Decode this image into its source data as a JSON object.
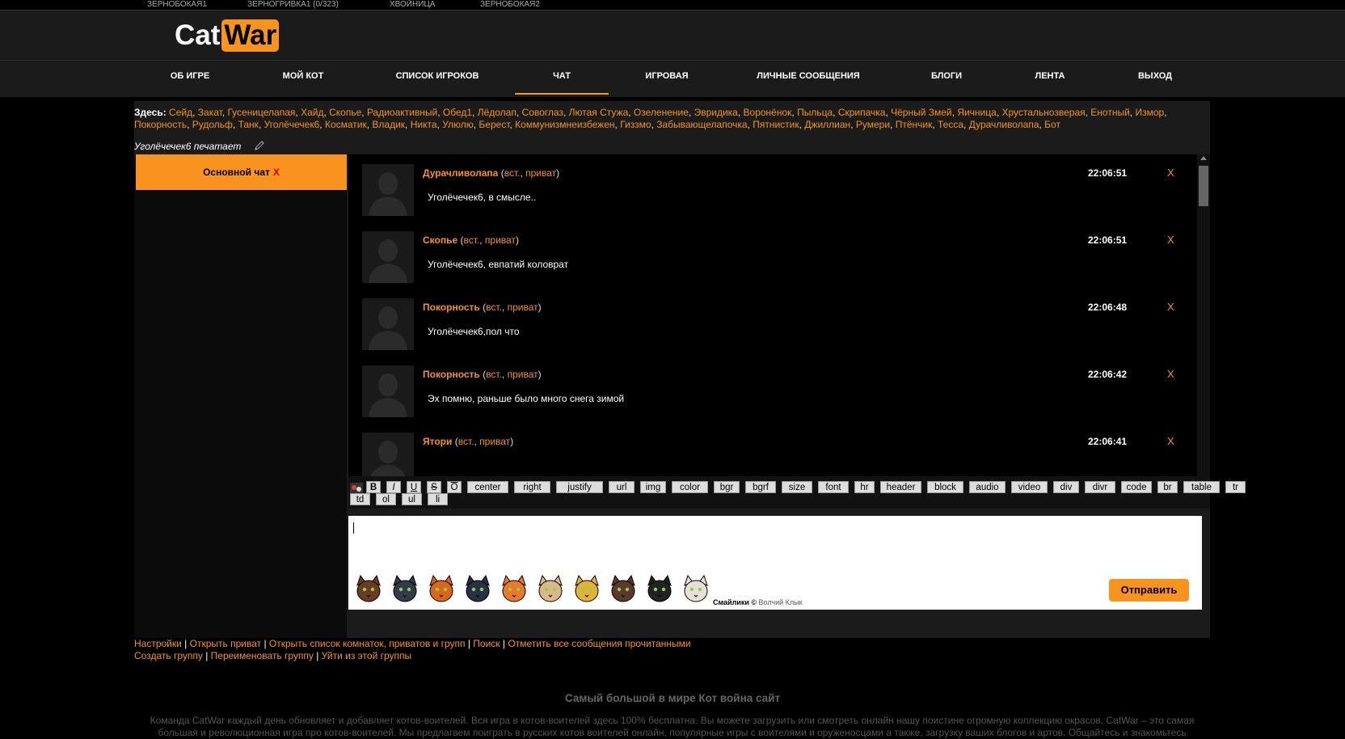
{
  "account_bar": {
    "accounts": [
      {
        "label": "ЗЕРНОБОКАЯ1"
      },
      {
        "label": "ЗЕРНОГРИВКА1 (0/323)"
      },
      {
        "label": "ХВОЙНИЦА"
      },
      {
        "label": "ЗЕРНОБОКАЯ2"
      }
    ]
  },
  "logo": {
    "part1": "Cat",
    "part2": "War"
  },
  "nav": {
    "items": [
      {
        "label": "ОБ ИГРЕ"
      },
      {
        "label": "МОЙ КОТ"
      },
      {
        "label": "СПИСОК ИГРОКОВ"
      },
      {
        "label": "ЧАТ",
        "active": true
      },
      {
        "label": "ИГРОВАЯ"
      },
      {
        "label": "ЛИЧНЫЕ СООБЩЕНИЯ"
      },
      {
        "label": "БЛОГИ"
      },
      {
        "label": "ЛЕНТА"
      },
      {
        "label": "ВЫХОД"
      }
    ]
  },
  "here": {
    "label": "Здесь:",
    "users": [
      "Сейд",
      "Закат",
      "Гусеницелапая",
      "Хайд",
      "Скопье",
      "Радиоактивный",
      "Обед1",
      "Лёдолап",
      "Совоглаз",
      "Лютая Стужа",
      "Озеленение",
      "Эвридика",
      "Воронёнок",
      "Пыльца",
      "Скрипачка",
      "Чёрный Змей",
      "Яичница",
      "Хрустальнозверая",
      "Енотный",
      "Измор",
      "Покорность",
      "Рудольф",
      "Танк",
      "Уголёчечек6",
      "Косматик",
      "Владик",
      "Никта",
      "Улюлю",
      "Берест",
      "Коммунизмнеизбежен",
      "Гиззмо",
      "Забывающелапочка",
      "Пятнистик",
      "Джиллиан",
      "Румери",
      "Птёнчик",
      "Тесса",
      "Дурачливолапа",
      "Бот"
    ],
    "typing": "Уголёчечек6 печатает"
  },
  "rooms": {
    "main_label": "Основной чат",
    "close_label": "X"
  },
  "messages": [
    {
      "author": "Дурачливолапа",
      "ins": "вст.",
      "priv": "приват",
      "text": "Уголёчечек6, в смысле..",
      "time": "22:06:51",
      "del": "X"
    },
    {
      "author": "Скопье",
      "ins": "вст.",
      "priv": "приват",
      "text": "Уголёчечек6, евпатий коловрат",
      "time": "22:06:51",
      "del": "X"
    },
    {
      "author": "Покорность",
      "ins": "вст.",
      "priv": "приват",
      "text": "Уголёчечек6,пол что",
      "time": "22:06:48",
      "del": "X"
    },
    {
      "author": "Покорность",
      "ins": "вст.",
      "priv": "приват",
      "text": "Эх помню, раньше было много снега зимой",
      "time": "22:06:42",
      "del": "X"
    },
    {
      "author": "Ятори",
      "ins": "вст.",
      "priv": "приват",
      "text": "",
      "time": "22:06:41",
      "del": "X"
    }
  ],
  "toolbar": {
    "row1": [
      "B",
      "I",
      "U",
      "S",
      "O",
      "center",
      "right",
      "justify",
      "url",
      "img",
      "color",
      "bgr",
      "bgrf",
      "size",
      "font",
      "hr",
      "header",
      "block",
      "audio",
      "video",
      "div",
      "divr",
      "code",
      "br",
      "table",
      "tr"
    ],
    "row2": [
      "td",
      "ol",
      "ul",
      "li"
    ]
  },
  "smileys": {
    "icons": [
      "brown-cat-smiley-icon",
      "grey-blue-cat-smiley-icon",
      "ginger-cat-smiley-icon",
      "navy-cat-question-smiley-icon",
      "orange-tabby-smiley-icon",
      "cream-cat-smiley-icon",
      "yellow-cat-smiley-icon",
      "brown-tabby-smiley-icon",
      "black-white-cat-smiley-icon",
      "calico-cat-smiley-icon"
    ],
    "credit_prefix": "Смайлики ©",
    "credit_author": "Волчий Клык"
  },
  "send_label": "Отправить",
  "footer": {
    "row1": [
      "Настройки",
      "Открыть приват",
      "Открыть список комнаток, приватов и групп",
      "Поиск",
      "Отметить все сообщения прочитанными"
    ],
    "row2": [
      "Создать группу",
      "Переименовать группу",
      "Уйти из этой группы"
    ],
    "separator": " | "
  },
  "promo": {
    "title": "Самый большой в мире Кот война сайт",
    "text": "Команда CatWar каждый день обновляет и добавляет котов-воителей. Вся игра в котов-воителей здесь 100% бесплатна. Вы можете загрузить или смотреть онлайн нашу поистине огромную коллекцию окрасов. CatWar – это самая большая и революционная игра про котов-воителей. Мы предлагаем поиграть в русских котов воителей онлайн, популярные игры с воителями и оруженосцами а также, загрузку ваших блогов и артов. Общайтесь и знакомьтесь"
  },
  "colors": {
    "accent": "#f7931e",
    "background": "#000000",
    "panel": "#1b1b1b"
  }
}
